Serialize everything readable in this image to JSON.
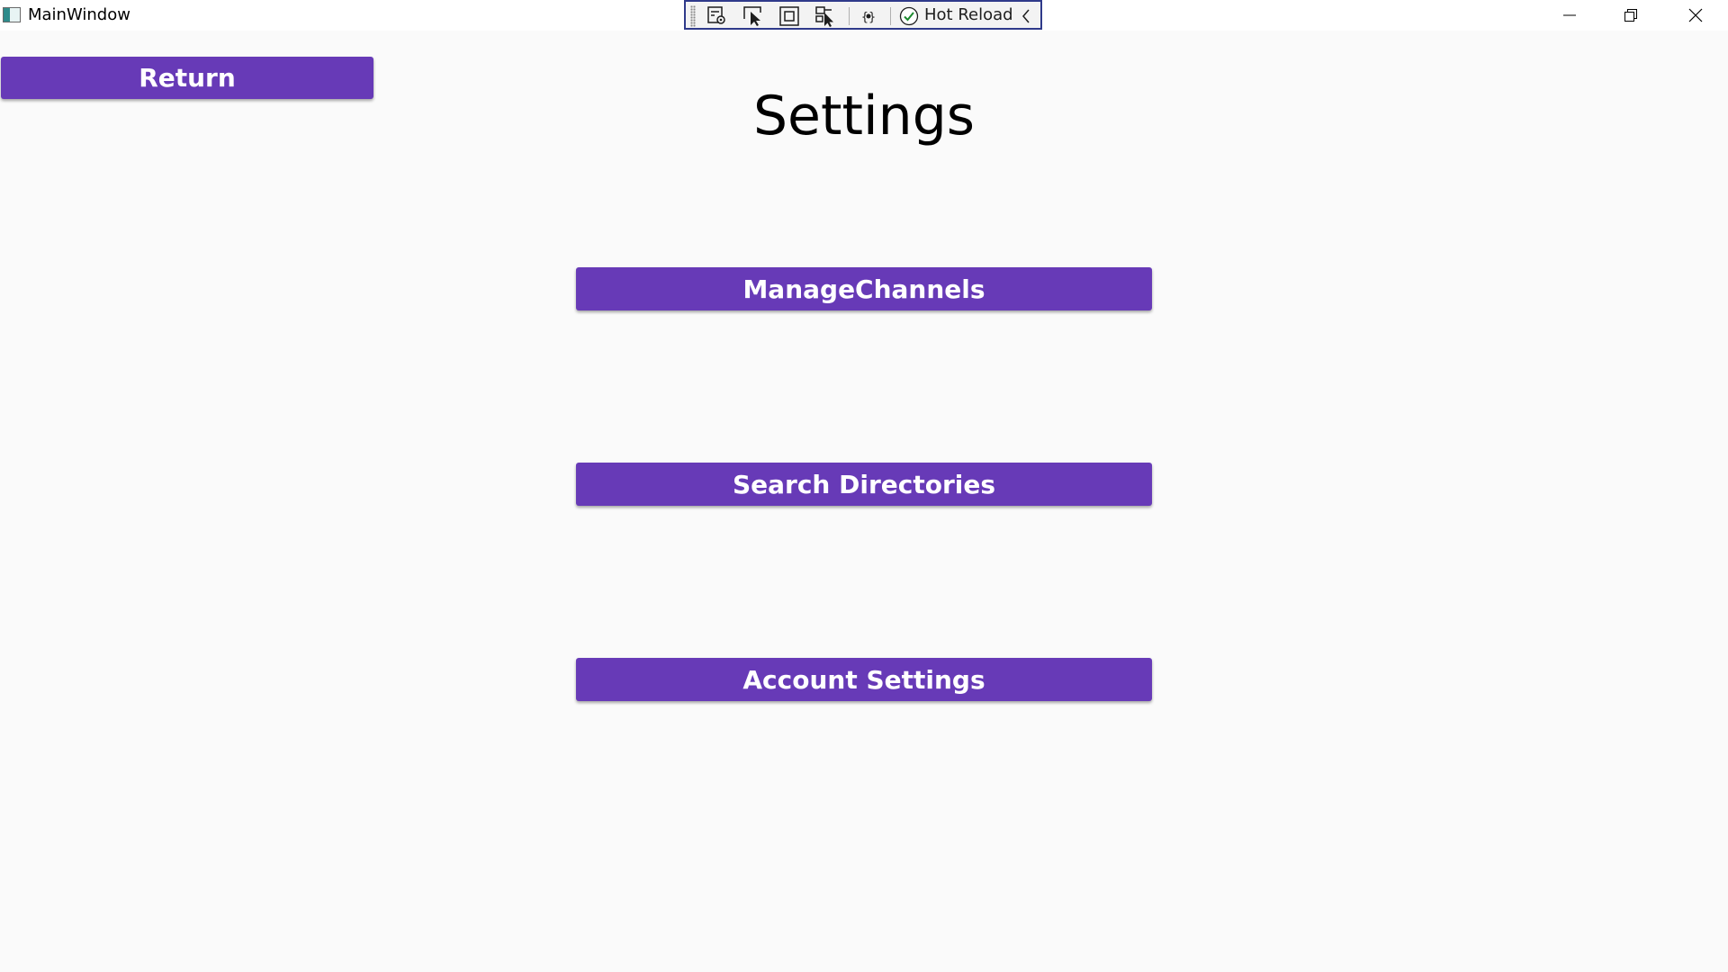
{
  "window": {
    "title": "MainWindow"
  },
  "toolbar": {
    "icons": [
      "go-to-live-visual-tree-icon",
      "select-element-icon",
      "display-layout-adorners-icon",
      "track-focused-element-icon",
      "binding-failures-icon"
    ],
    "hot_reload_label": "Hot Reload",
    "hot_reload_status_icon": "check-circle-icon",
    "collapse_icon": "chevron-left-icon"
  },
  "page": {
    "title": "Settings",
    "return_label": "Return",
    "buttons": [
      {
        "label": "ManageChannels"
      },
      {
        "label": "Search Directories"
      },
      {
        "label": "Account Settings"
      }
    ]
  },
  "colors": {
    "button_background": "#673ab7",
    "button_text": "#ffffff",
    "window_background": "#fafafa",
    "toolbar_border": "#2f3a8a"
  }
}
